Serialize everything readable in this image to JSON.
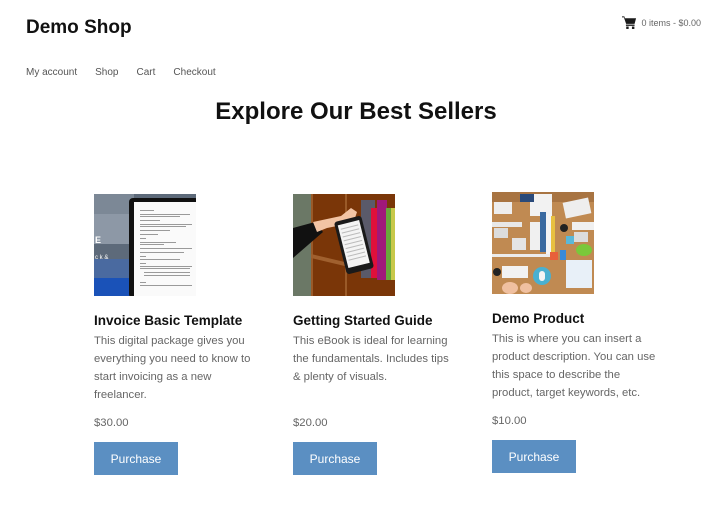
{
  "header": {
    "site_title": "Demo Shop",
    "cart_icon": "shopping-cart-icon",
    "cart_summary": "0 items - $0.00"
  },
  "nav": {
    "items": [
      {
        "label": "My account"
      },
      {
        "label": "Shop"
      },
      {
        "label": "Cart"
      },
      {
        "label": "Checkout"
      }
    ]
  },
  "main": {
    "title": "Explore Our Best Sellers",
    "products": [
      {
        "name": "Invoice Basic Template",
        "description": "This digital package gives you everything you need to know to start invoicing as a new freelancer.",
        "price": "$30.00",
        "button_label": "Purchase",
        "image": "invoice-document-image"
      },
      {
        "name": "Getting Started Guide",
        "description": "This eBook is ideal for learning the fundamentals. Includes tips & plenty of visuals.",
        "price": "$20.00",
        "button_label": "Purchase",
        "image": "ebook-reader-image"
      },
      {
        "name": "Demo Product",
        "description": "This is where you can insert a product description. You can use this space to describe the product, target keywords, etc.",
        "price": "$10.00",
        "button_label": "Purchase",
        "image": "office-desk-image"
      }
    ]
  },
  "colors": {
    "button_bg": "#5b8fc2",
    "button_text": "#ffffff",
    "body_text": "#666666",
    "heading_text": "#111111"
  }
}
